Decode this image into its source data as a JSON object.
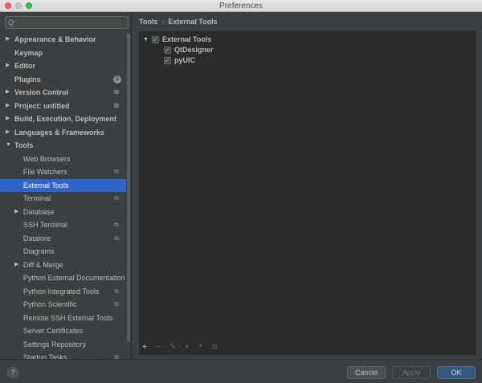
{
  "window": {
    "title": "Preferences"
  },
  "search": {
    "placeholder": "",
    "value": ""
  },
  "sidebar": {
    "items": [
      {
        "label": "Appearance & Behavior",
        "expandable": true,
        "expanded": false,
        "bold": true,
        "level": 0,
        "icon": ""
      },
      {
        "label": "Keymap",
        "expandable": false,
        "bold": true,
        "level": 0,
        "icon": ""
      },
      {
        "label": "Editor",
        "expandable": true,
        "expanded": false,
        "bold": true,
        "level": 0,
        "icon": ""
      },
      {
        "label": "Plugins",
        "expandable": false,
        "bold": true,
        "level": 0,
        "icon": "badge",
        "badge": "1"
      },
      {
        "label": "Version Control",
        "expandable": true,
        "expanded": false,
        "bold": true,
        "level": 0,
        "icon": "project-icon"
      },
      {
        "label": "Project: untitled",
        "expandable": true,
        "expanded": false,
        "bold": true,
        "level": 0,
        "icon": "project-icon"
      },
      {
        "label": "Build, Execution, Deployment",
        "expandable": true,
        "expanded": false,
        "bold": true,
        "level": 0,
        "icon": ""
      },
      {
        "label": "Languages & Frameworks",
        "expandable": true,
        "expanded": false,
        "bold": true,
        "level": 0,
        "icon": ""
      },
      {
        "label": "Tools",
        "expandable": true,
        "expanded": true,
        "bold": true,
        "level": 0,
        "icon": ""
      },
      {
        "label": "Web Browsers",
        "expandable": false,
        "bold": false,
        "level": 1,
        "icon": ""
      },
      {
        "label": "File Watchers",
        "expandable": false,
        "bold": false,
        "level": 1,
        "icon": "project-icon"
      },
      {
        "label": "External Tools",
        "expandable": false,
        "bold": false,
        "level": 1,
        "icon": "",
        "selected": true
      },
      {
        "label": "Terminal",
        "expandable": false,
        "bold": false,
        "level": 1,
        "icon": "project-icon"
      },
      {
        "label": "Database",
        "expandable": true,
        "expanded": false,
        "bold": false,
        "level": 1,
        "icon": ""
      },
      {
        "label": "SSH Terminal",
        "expandable": false,
        "bold": false,
        "level": 1,
        "icon": "project-icon"
      },
      {
        "label": "Datalore",
        "expandable": false,
        "bold": false,
        "level": 1,
        "icon": "project-icon"
      },
      {
        "label": "Diagrams",
        "expandable": false,
        "bold": false,
        "level": 1,
        "icon": ""
      },
      {
        "label": "Diff & Merge",
        "expandable": true,
        "expanded": false,
        "bold": false,
        "level": 1,
        "icon": ""
      },
      {
        "label": "Python External Documentation",
        "expandable": false,
        "bold": false,
        "level": 1,
        "icon": ""
      },
      {
        "label": "Python Integrated Tools",
        "expandable": false,
        "bold": false,
        "level": 1,
        "icon": "project-icon"
      },
      {
        "label": "Python Scientific",
        "expandable": false,
        "bold": false,
        "level": 1,
        "icon": "project-icon"
      },
      {
        "label": "Remote SSH External Tools",
        "expandable": false,
        "bold": false,
        "level": 1,
        "icon": ""
      },
      {
        "label": "Server Certificates",
        "expandable": false,
        "bold": false,
        "level": 1,
        "icon": ""
      },
      {
        "label": "Settings Repository",
        "expandable": false,
        "bold": false,
        "level": 1,
        "icon": ""
      },
      {
        "label": "Startup Tasks",
        "expandable": false,
        "bold": false,
        "level": 1,
        "icon": "project-icon"
      }
    ]
  },
  "breadcrumb": {
    "parent": "Tools",
    "separator": "›",
    "current": "External Tools"
  },
  "tools_tree": [
    {
      "label": "External Tools",
      "checked": true,
      "level": 0,
      "expandable": true
    },
    {
      "label": "QtDesigner",
      "checked": true,
      "level": 1,
      "expandable": false
    },
    {
      "label": "pyUIC",
      "checked": true,
      "level": 1,
      "expandable": false
    }
  ],
  "toolbar": {
    "add": "+",
    "remove": "−",
    "edit": "✎",
    "up": "▲",
    "down": "▼",
    "copy": "⧉"
  },
  "buttons": {
    "help": "?",
    "cancel": "Cancel",
    "apply": "Apply",
    "ok": "OK"
  },
  "colors": {
    "background": "#3c3f41",
    "panel": "#2b2b2b",
    "selection": "#2f65ca",
    "default_button": "#365880"
  }
}
